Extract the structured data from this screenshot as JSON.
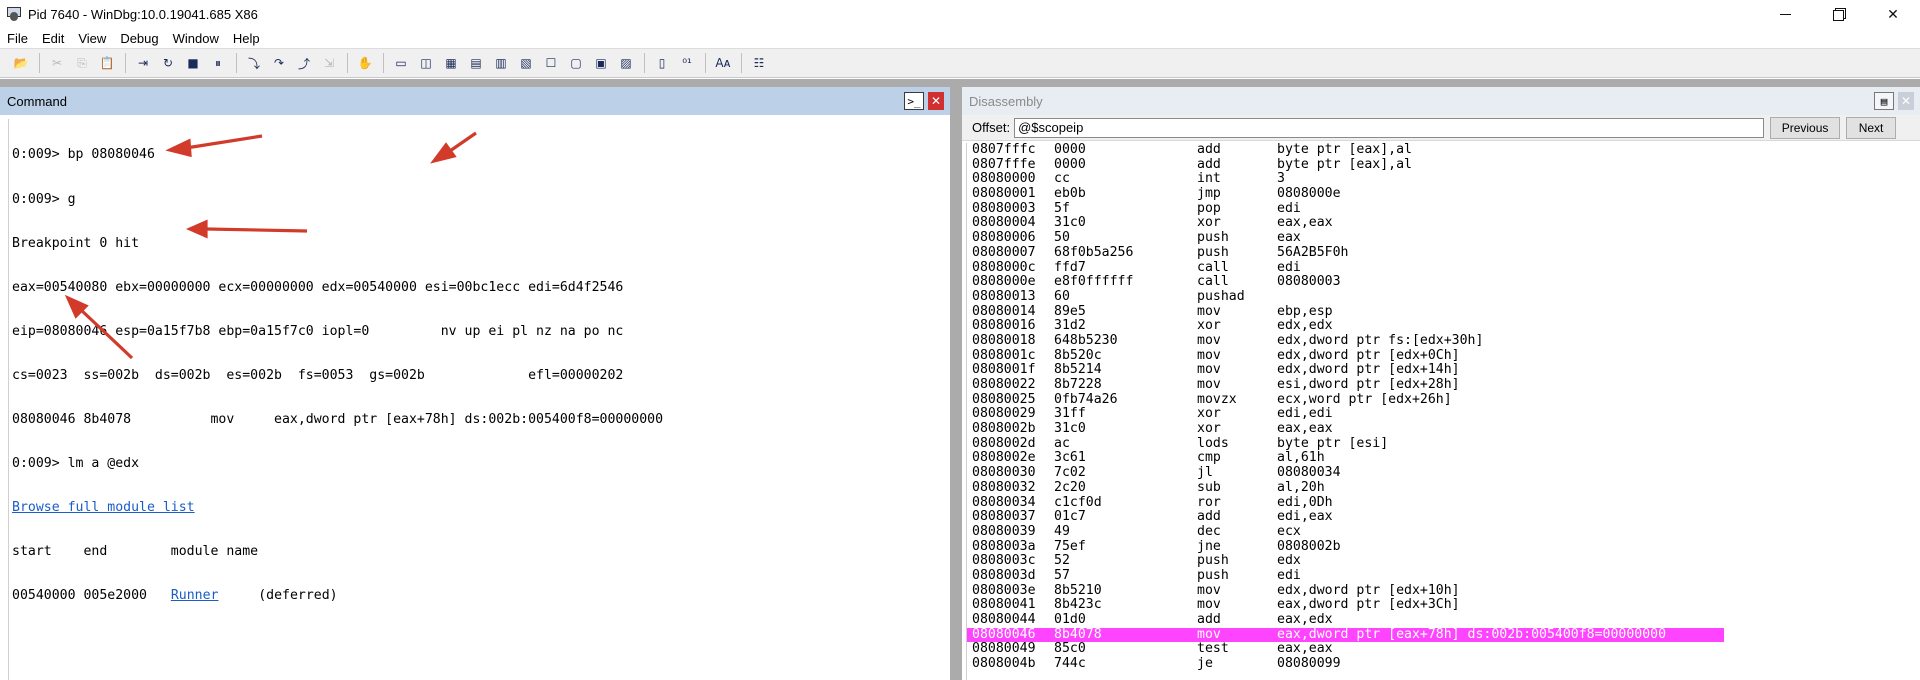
{
  "window": {
    "title": "Pid 7640 - WinDbg:10.0.19041.685 X86",
    "controls": {
      "minimize": "—",
      "restore": "❐",
      "close": "✕"
    }
  },
  "menu": [
    "File",
    "Edit",
    "View",
    "Debug",
    "Window",
    "Help"
  ],
  "toolbar": {
    "groups": [
      [
        "open-icon"
      ],
      [
        "cut-icon",
        "copy-icon",
        "paste-icon"
      ],
      [
        "go-icon",
        "restart-icon",
        "stop-debugging-icon",
        "break-icon"
      ],
      [
        "step-into-icon",
        "step-over-icon",
        "step-out-icon",
        "run-to-cursor-icon"
      ],
      [
        "hand-icon"
      ],
      [
        "command-window-icon",
        "watch-window-icon",
        "locals-window-icon",
        "registers-window-icon",
        "memory-window-icon",
        "call-stack-window-icon",
        "disassembly-window-icon",
        "scratch-pad-icon",
        "processes-threads-icon",
        "command-browser-icon"
      ],
      [
        "source-mode-icon",
        "hex-mode-icon"
      ],
      [
        "font-icon"
      ],
      [
        "options-icon"
      ]
    ]
  },
  "command_pane": {
    "title": "Command",
    "lines": [
      "0:009> bp 08080046",
      "0:009> g",
      "Breakpoint 0 hit",
      "eax=00540080 ebx=00000000 ecx=00000000 edx=00540000 esi=00bc1ecc edi=6d4f2546",
      "eip=08080046 esp=0a15f7b8 ebp=0a15f7c0 iopl=0         nv up ei pl nz na po nc",
      "cs=0023  ss=002b  ds=002b  es=002b  fs=0053  gs=002b             efl=00000202",
      "08080046 8b4078          mov     eax,dword ptr [eax+78h] ds:002b:005400f8=00000000",
      "0:009> lm a @edx"
    ],
    "browse_link": "Browse full module list",
    "module_header": "start    end        module name",
    "module_row": {
      "start": "00540000",
      "end": "005e2000",
      "name": "Runner",
      "status": "(deferred)"
    }
  },
  "disassembly_pane": {
    "title": "Disassembly",
    "offset_label": "Offset:",
    "offset_value": "@$scopeip",
    "previous_label": "Previous",
    "next_label": "Next",
    "highlight_color": "#ff44ff",
    "rows": [
      {
        "addr": "0807fffc",
        "bytes": "0000",
        "mn": "add",
        "ops": "byte ptr [eax],al"
      },
      {
        "addr": "0807fffe",
        "bytes": "0000",
        "mn": "add",
        "ops": "byte ptr [eax],al"
      },
      {
        "addr": "08080000",
        "bytes": "cc",
        "mn": "int",
        "ops": "3"
      },
      {
        "addr": "08080001",
        "bytes": "eb0b",
        "mn": "jmp",
        "ops": "0808000e"
      },
      {
        "addr": "08080003",
        "bytes": "5f",
        "mn": "pop",
        "ops": "edi"
      },
      {
        "addr": "08080004",
        "bytes": "31c0",
        "mn": "xor",
        "ops": "eax,eax"
      },
      {
        "addr": "08080006",
        "bytes": "50",
        "mn": "push",
        "ops": "eax"
      },
      {
        "addr": "08080007",
        "bytes": "68f0b5a256",
        "mn": "push",
        "ops": "56A2B5F0h"
      },
      {
        "addr": "0808000c",
        "bytes": "ffd7",
        "mn": "call",
        "ops": "edi"
      },
      {
        "addr": "0808000e",
        "bytes": "e8f0ffffff",
        "mn": "call",
        "ops": "08080003"
      },
      {
        "addr": "08080013",
        "bytes": "60",
        "mn": "pushad",
        "ops": ""
      },
      {
        "addr": "08080014",
        "bytes": "89e5",
        "mn": "mov",
        "ops": "ebp,esp"
      },
      {
        "addr": "08080016",
        "bytes": "31d2",
        "mn": "xor",
        "ops": "edx,edx"
      },
      {
        "addr": "08080018",
        "bytes": "648b5230",
        "mn": "mov",
        "ops": "edx,dword ptr fs:[edx+30h]"
      },
      {
        "addr": "0808001c",
        "bytes": "8b520c",
        "mn": "mov",
        "ops": "edx,dword ptr [edx+0Ch]"
      },
      {
        "addr": "0808001f",
        "bytes": "8b5214",
        "mn": "mov",
        "ops": "edx,dword ptr [edx+14h]"
      },
      {
        "addr": "08080022",
        "bytes": "8b7228",
        "mn": "mov",
        "ops": "esi,dword ptr [edx+28h]"
      },
      {
        "addr": "08080025",
        "bytes": "0fb74a26",
        "mn": "movzx",
        "ops": "ecx,word ptr [edx+26h]"
      },
      {
        "addr": "08080029",
        "bytes": "31ff",
        "mn": "xor",
        "ops": "edi,edi"
      },
      {
        "addr": "0808002b",
        "bytes": "31c0",
        "mn": "xor",
        "ops": "eax,eax"
      },
      {
        "addr": "0808002d",
        "bytes": "ac",
        "mn": "lods",
        "ops": "byte ptr [esi]"
      },
      {
        "addr": "0808002e",
        "bytes": "3c61",
        "mn": "cmp",
        "ops": "al,61h"
      },
      {
        "addr": "08080030",
        "bytes": "7c02",
        "mn": "jl",
        "ops": "08080034"
      },
      {
        "addr": "08080032",
        "bytes": "2c20",
        "mn": "sub",
        "ops": "al,20h"
      },
      {
        "addr": "08080034",
        "bytes": "c1cf0d",
        "mn": "ror",
        "ops": "edi,0Dh"
      },
      {
        "addr": "08080037",
        "bytes": "01c7",
        "mn": "add",
        "ops": "edi,eax"
      },
      {
        "addr": "08080039",
        "bytes": "49",
        "mn": "dec",
        "ops": "ecx"
      },
      {
        "addr": "0808003a",
        "bytes": "75ef",
        "mn": "jne",
        "ops": "0808002b"
      },
      {
        "addr": "0808003c",
        "bytes": "52",
        "mn": "push",
        "ops": "edx"
      },
      {
        "addr": "0808003d",
        "bytes": "57",
        "mn": "push",
        "ops": "edi"
      },
      {
        "addr": "0808003e",
        "bytes": "8b5210",
        "mn": "mov",
        "ops": "edx,dword ptr [edx+10h]"
      },
      {
        "addr": "08080041",
        "bytes": "8b423c",
        "mn": "mov",
        "ops": "eax,dword ptr [edx+3Ch]"
      },
      {
        "addr": "08080044",
        "bytes": "01d0",
        "mn": "add",
        "ops": "eax,edx"
      },
      {
        "addr": "08080046",
        "bytes": "8b4078",
        "mn": "mov",
        "ops": "eax,dword ptr [eax+78h] ds:002b:005400f8=00000000",
        "highlight": true
      },
      {
        "addr": "08080049",
        "bytes": "85c0",
        "mn": "test",
        "ops": "eax,eax"
      },
      {
        "addr": "0808004b",
        "bytes": "744c",
        "mn": "je",
        "ops": "08080099"
      }
    ]
  }
}
